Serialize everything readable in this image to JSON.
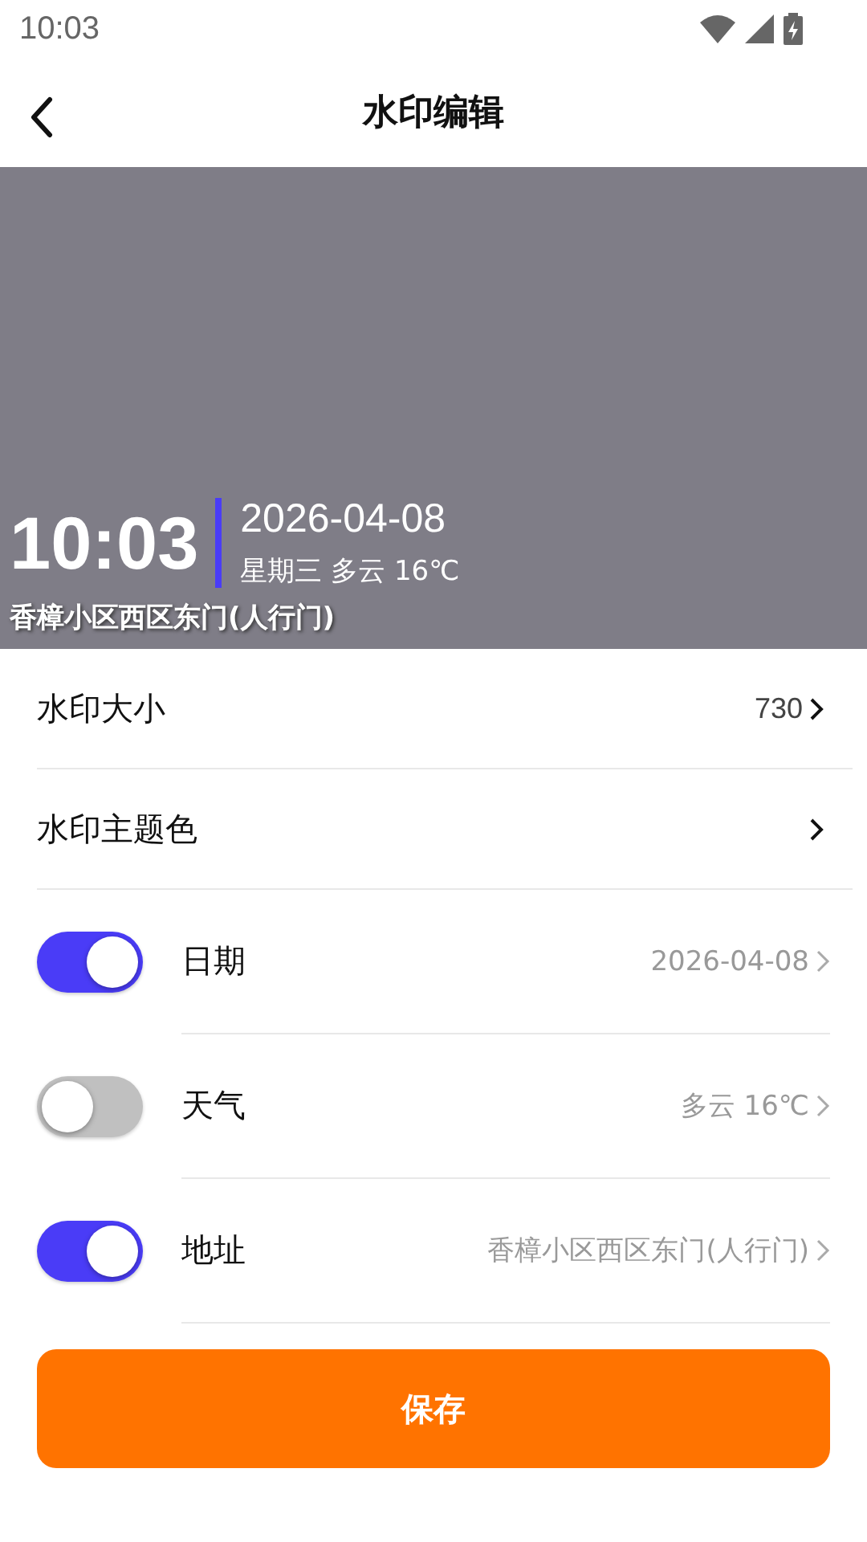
{
  "status_bar": {
    "time": "10:03"
  },
  "header": {
    "title": "水印编辑"
  },
  "preview": {
    "time": "10:03",
    "date": "2026-04-08",
    "weather": "星期三 多云  16℃",
    "address": "香樟小区西区东门(人行门)"
  },
  "settings": [
    {
      "label": "水印大小",
      "value": "730"
    },
    {
      "label": "水印主题色"
    }
  ],
  "toggles": [
    {
      "label": "日期",
      "on": true,
      "value": "2026-04-08"
    },
    {
      "label": "天气",
      "on": false,
      "value": "多云  16℃"
    },
    {
      "label": "地址",
      "on": true,
      "value": "香樟小区西区东门(人行门)"
    }
  ],
  "save_button": "保存"
}
